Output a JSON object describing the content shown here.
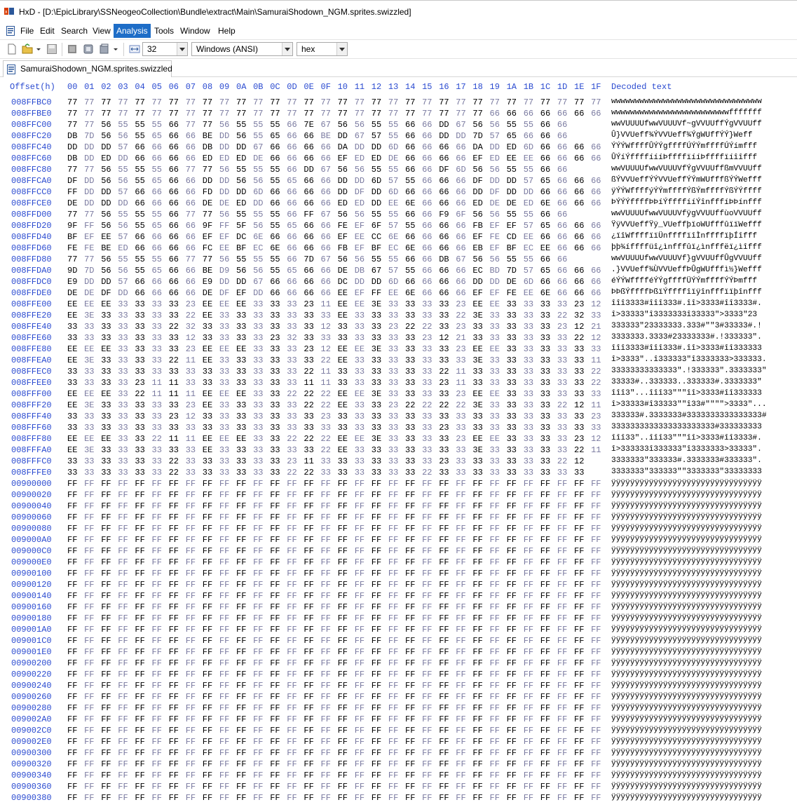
{
  "window": {
    "title": "HxD - [D:\\EpicLibrary\\SSNeogeoCollection\\Bundle\\extract\\Main\\SamuraiShodown_NGM.sprites.swizzled]"
  },
  "menu": {
    "items": [
      "File",
      "Edit",
      "Search",
      "View",
      "Analysis",
      "Tools",
      "Window",
      "Help"
    ],
    "active": "Analysis"
  },
  "toolbar": {
    "bytes_per_row": "32",
    "charset": "Windows (ANSI)",
    "mode": "hex"
  },
  "tab": {
    "label": "SamuraiShodown_NGM.sprites.swizzled"
  },
  "colors": {
    "offset_blue": "#2a4ad0",
    "accent": "#1e6dc7",
    "alt_byte": "#7a7aa0"
  },
  "hex": {
    "offset_header": "Offset(h)",
    "column_headers": [
      "00",
      "01",
      "02",
      "03",
      "04",
      "05",
      "06",
      "07",
      "08",
      "09",
      "0A",
      "0B",
      "0C",
      "0D",
      "0E",
      "0F",
      "10",
      "11",
      "12",
      "13",
      "14",
      "15",
      "16",
      "17",
      "18",
      "19",
      "1A",
      "1B",
      "1C",
      "1D",
      "1E",
      "1F"
    ],
    "decoded_header": "Decoded text",
    "rows": [
      {
        "offset": "008FFBC0",
        "bytes": "77 77 77 77 77 77 77 77 77 77 77 77 77 77 77 77 77 77 77 77 77 77 77 77 77 77 77 77 77 77 77 77",
        "text": "wwwwwwwwwwwwwwwwwwwwwwwwwwwwwwww"
      },
      {
        "offset": "008FFBE0",
        "bytes": "77 77 77 77 77 77 77 77 77 77 77 77 77 77 77 77 77 77 77 77 77 77 77 77 77 66 66 66 66 66 66 66",
        "text": "wwwwwwwwwwwwwwwwwwwwwwwwwfffffff"
      },
      {
        "offset": "008FFC00",
        "bytes": "77 77 56 55 55 55 66 77 77 56 55 55 55 66 7E 67 56 56 55 55 66 66 DD 67 56 56 55 55 66 66",
        "text": "wwVUUUUfwwVUUUVf~gVVUUffÝgVVUUff"
      },
      {
        "offset": "008FFC20",
        "bytes": "DB 7D 56 56 55 65 66 66 BE DD 56 55 65 66 66 BE DD 67 57 55 66 66 DD DD 7D 57 65 66 66 66",
        "text": "Û}VVUeff¾ÝVVUeff¾ÝgWUffÝÝ}Weff"
      },
      {
        "offset": "008FFC40",
        "bytes": "DD DD DD 57 66 66 66 66 DB DD DD 67 66 66 66 66 DA DD DD 6D 66 66 66 66 DA DD ED 6D 66 66 66 66",
        "text": "ÝÝÝWffffÛÝÝgffffÚÝÝmffffÚÝímfff"
      },
      {
        "offset": "008FFC60",
        "bytes": "DB DD ED DD 66 66 66 66 ED ED ED DE 66 66 66 66 EF ED ED DE 66 66 66 66 EF ED EE EE 66 66 66 66",
        "text": "ÛÝíÝffffíííÞffffïííÞffffïíîîfff"
      },
      {
        "offset": "008FFC80",
        "bytes": "77 77 56 55 55 55 66 77 77 56 55 55 55 66 DD 67 56 56 55 55 66 66 DF 6D 56 56 55 55 66 66",
        "text": "wwVUUUUfwwVUUUVfÝgVVUUffßmVVUUff"
      },
      {
        "offset": "008FFCA0",
        "bytes": "DF DD 56 56 55 65 66 66 DD DD 56 56 55 65 66 66 DD DD 6D 57 55 66 66 66 DF DD DD 57 65 66 66 66",
        "text": "ßÝVVUeffÝÝVVUeffÝÝmWUfffßÝÝWefff"
      },
      {
        "offset": "008FFCC0",
        "bytes": "FF DD DD 57 66 66 66 66 FD DD DD 6D 66 66 66 66 DD DF DD 6D 66 66 66 66 DD DF DD DD 66 66 66 66",
        "text": "ÿÝÝWffffýÝÝmffffÝßÝmffffÝßÝÝffff"
      },
      {
        "offset": "008FFCE0",
        "bytes": "DE DD DD DD 66 66 66 66 DE DE ED DD 66 66 66 66 ED ED DD EE 6E 66 66 66 ED DE DE ED 6E 66 66 66",
        "text": "ÞÝÝÝffffÞÞíÝffffííÝînfffíÞÞínfff"
      },
      {
        "offset": "008FFD00",
        "bytes": "77 77 56 55 55 55 66 77 77 56 55 55 55 66 FF 67 56 56 55 55 66 66 F9 6F 56 56 55 55 66 66",
        "text": "wwVUUUUfwwVUUUVfÿgVVUUffùoVVUUff"
      },
      {
        "offset": "008FFD20",
        "bytes": "9F FF 56 56 55 65 66 66 9F FF 5F 56 55 65 66 66 FE EF 6F 57 55 66 66 66 FB EF EF 57 65 66 66 66",
        "text": "ŸÿVVUeffŸÿ_VUeffþïoWUfffûïïWefff"
      },
      {
        "offset": "008FFD40",
        "bytes": "BF EF EE 57 66 66 66 66 EF EF DC 6E 66 66 66 66 EF EE CC 6E 66 66 66 66 EF FE CD EE 66 66 66 66",
        "text": "¿ïîWffffïïÜnffffïîÌnffffïþÍîfff"
      },
      {
        "offset": "008FFD60",
        "bytes": "FE FE BE ED 66 66 66 66 FC EE BF EC 6E 66 66 66 FB EF BF EC 6E 66 66 66 EB EF BF EC EE 66 66 66",
        "text": "þþ¾íffffüî¿ìnfffûï¿ìnfffëï¿ìîfff"
      },
      {
        "offset": "008FFD80",
        "bytes": "77 77 56 55 55 55 66 77 77 56 55 55 55 66 7D 67 56 56 55 55 66 66 DB 67 56 56 55 55 66 66",
        "text": "wwVUUUUfwwVUUUVf}gVVUUffÛgVVUUff"
      },
      {
        "offset": "008FFDA0",
        "bytes": "9D 7D 56 56 55 65 66 66 BE D9 56 56 55 65 66 66 DE DB 67 57 55 66 66 66 EC BD 7D 57 65 66 66 66",
        "text": ".}VVUeff¾ÙVVUeffÞÛgWUfffì½}Wefff"
      },
      {
        "offset": "008FFDC0",
        "bytes": "E9 DD DD 57 66 66 66 66 E9 DD DD 67 66 66 66 66 DC DD DD 6D 66 66 66 66 DD DD DE 6D 66 66 66 66",
        "text": "éÝÝWfffféÝÝgffffÜÝÝmffffÝÝÞmfff"
      },
      {
        "offset": "008FFDE0",
        "bytes": "DE DE DF DD 66 66 66 66 DE DF EF DD 66 66 66 66 EE EF FF EE 6E 66 66 66 EF EF FE EE 6E 66 66 66",
        "text": "ÞÞßÝffffÞßïÝffffîïÿînfffïïþînfff"
      },
      {
        "offset": "008FFE00",
        "bytes": "EE EE EE 33 33 33 33 23 EE EE EE 33 33 33 23 11 EE EE 3E 33 33 33 33 23 EE EE 33 33 33 33 23 12",
        "text": "îîî3333#îîî333#.îî>3333#îî3333#."
      },
      {
        "offset": "008FFE20",
        "bytes": "EE 3E 33 33 33 33 33 22 EE 33 33 33 33 33 33 33 EE 33 33 33 33 33 33 22 3E 33 33 33 33 22 32 33",
        "text": "î>33333\"î3333333î33333\">3333\"23"
      },
      {
        "offset": "008FFE40",
        "bytes": "33 33 33 33 33 33 22 32 33 33 33 33 33 33 33 12 33 33 33 23 22 22 33 23 33 33 33 33 33 23 12 21",
        "text": "333333\"23333333.333#\"\"3#33333#.!"
      },
      {
        "offset": "008FFE60",
        "bytes": "33 33 33 33 33 33 33 12 33 33 33 33 23 32 33 33 33 33 33 33 33 23 12 21 33 33 33 33 33 33 22 12",
        "text": "3333333.3333#23333333#.!333333\"."
      },
      {
        "offset": "008FFE80",
        "bytes": "EE EE EE 33 33 33 33 23 EE EE EE 33 33 33 23 12 EE EE 3E 33 33 33 33 23 EE EE 33 33 33 33 33 33",
        "text": "îîî3333#îîî333#.îî>3333#îî333333"
      },
      {
        "offset": "008FFEA0",
        "bytes": "EE 3E 33 33 33 33 22 11 EE 33 33 33 33 33 33 22 EE 33 33 33 33 33 33 33 3E 33 33 33 33 33 33 11",
        "text": "î>3333\"..î333333\"î3333333>333333."
      },
      {
        "offset": "008FFEC0",
        "bytes": "33 33 33 33 33 33 33 33 33 33 33 33 33 33 22 11 33 33 33 33 33 33 22 11 33 33 33 33 33 33 33 22",
        "text": "33333333333333\".!333333\".3333333\""
      },
      {
        "offset": "008FFEE0",
        "bytes": "33 33 33 33 23 11 11 33 33 33 33 33 33 33 11 11 33 33 33 33 33 33 23 11 33 33 33 33 33 33 33 22",
        "text": "33333#..333333..333333#.3333333\""
      },
      {
        "offset": "008FFF00",
        "bytes": "EE EE EE 33 22 11 11 11 EE EE EE 33 33 22 22 22 EE EE 3E 33 33 33 33 23 EE EE 33 33 33 33 33 33",
        "text": "îîî3\"...îîî33\"\"\"îî>3333#îî333333"
      },
      {
        "offset": "008FFF20",
        "bytes": "EE 3E 33 33 33 33 33 23 EE 33 33 33 33 33 22 22 EE 33 33 23 22 22 22 22 3E 33 33 33 33 22 12 11",
        "text": "î>33333#î33333\"\"î33#\"\"\"\">3333\"..."
      },
      {
        "offset": "008FFF40",
        "bytes": "33 33 33 33 33 33 23 12 33 33 33 33 33 33 33 23 33 33 33 33 33 33 33 33 33 33 33 33 33 33 33 23",
        "text": "333333#.3333333#3333333333333333#"
      },
      {
        "offset": "008FFF60",
        "bytes": "33 33 33 33 33 33 33 33 33 33 33 33 33 33 33 33 33 33 33 33 33 33 23 33 33 33 33 33 33 33 33 33",
        "text": "3333333333333333333333#333333333"
      },
      {
        "offset": "008FFF80",
        "bytes": "EE EE EE 33 33 22 11 11 EE EE EE 33 33 22 22 22 EE EE 3E 33 33 33 33 23 EE EE 33 33 33 33 23 12",
        "text": "îîî33\"..îîî33\"\"\"îî>3333#îî3333#."
      },
      {
        "offset": "008FFFA0",
        "bytes": "EE 3E 33 33 33 33 33 33 EE 33 33 33 33 33 33 22 EE 33 33 33 33 33 33 33 3E 33 33 33 33 33 22 11",
        "text": "î>333333î333333\"î3333333>33333\"."
      },
      {
        "offset": "008FFFC0",
        "bytes": "33 33 33 33 33 33 22 33 33 33 33 33 33 23 11 33 33 33 33 33 33 33 23 33 33 33 33 33 33 22 12",
        "text": "3333333\"333333#.3333333#333333\"."
      },
      {
        "offset": "008FFFE0",
        "bytes": "33 33 33 33 33 33 22 33 33 33 33 33 33 22 22 33 33 33 33 33 33 22 33 33 33 33 33 33 33 33 33",
        "text": "3333333\"333333\"\"3333333\"33333333"
      },
      {
        "offset": "00900000",
        "bytes": "FF FF FF FF FF FF FF FF FF FF FF FF FF FF FF FF FF FF FF FF FF FF FF FF FF FF FF FF FF FF FF FF",
        "text": "ÿÿÿÿÿÿÿÿÿÿÿÿÿÿÿÿÿÿÿÿÿÿÿÿÿÿÿÿÿÿÿÿ"
      },
      {
        "offset": "00900020",
        "bytes": "FF FF FF FF FF FF FF FF FF FF FF FF FF FF FF FF FF FF FF FF FF FF FF FF FF FF FF FF FF FF FF FF",
        "text": "ÿÿÿÿÿÿÿÿÿÿÿÿÿÿÿÿÿÿÿÿÿÿÿÿÿÿÿÿÿÿÿÿ"
      },
      {
        "offset": "00900040",
        "bytes": "FF FF FF FF FF FF FF FF FF FF FF FF FF FF FF FF FF FF FF FF FF FF FF FF FF FF FF FF FF FF FF FF",
        "text": "ÿÿÿÿÿÿÿÿÿÿÿÿÿÿÿÿÿÿÿÿÿÿÿÿÿÿÿÿÿÿÿÿ"
      },
      {
        "offset": "00900060",
        "bytes": "FF FF FF FF FF FF FF FF FF FF FF FF FF FF FF FF FF FF FF FF FF FF FF FF FF FF FF FF FF FF FF FF",
        "text": "ÿÿÿÿÿÿÿÿÿÿÿÿÿÿÿÿÿÿÿÿÿÿÿÿÿÿÿÿÿÿÿÿ"
      },
      {
        "offset": "00900080",
        "bytes": "FF FF FF FF FF FF FF FF FF FF FF FF FF FF FF FF FF FF FF FF FF FF FF FF FF FF FF FF FF FF FF FF",
        "text": "ÿÿÿÿÿÿÿÿÿÿÿÿÿÿÿÿÿÿÿÿÿÿÿÿÿÿÿÿÿÿÿÿ"
      },
      {
        "offset": "009000A0",
        "bytes": "FF FF FF FF FF FF FF FF FF FF FF FF FF FF FF FF FF FF FF FF FF FF FF FF FF FF FF FF FF FF FF FF",
        "text": "ÿÿÿÿÿÿÿÿÿÿÿÿÿÿÿÿÿÿÿÿÿÿÿÿÿÿÿÿÿÿÿÿ"
      },
      {
        "offset": "009000C0",
        "bytes": "FF FF FF FF FF FF FF FF FF FF FF FF FF FF FF FF FF FF FF FF FF FF FF FF FF FF FF FF FF FF FF FF",
        "text": "ÿÿÿÿÿÿÿÿÿÿÿÿÿÿÿÿÿÿÿÿÿÿÿÿÿÿÿÿÿÿÿÿ"
      },
      {
        "offset": "009000E0",
        "bytes": "FF FF FF FF FF FF FF FF FF FF FF FF FF FF FF FF FF FF FF FF FF FF FF FF FF FF FF FF FF FF FF FF",
        "text": "ÿÿÿÿÿÿÿÿÿÿÿÿÿÿÿÿÿÿÿÿÿÿÿÿÿÿÿÿÿÿÿÿ"
      },
      {
        "offset": "00900100",
        "bytes": "FF FF FF FF FF FF FF FF FF FF FF FF FF FF FF FF FF FF FF FF FF FF FF FF FF FF FF FF FF FF FF FF",
        "text": "ÿÿÿÿÿÿÿÿÿÿÿÿÿÿÿÿÿÿÿÿÿÿÿÿÿÿÿÿÿÿÿÿ"
      },
      {
        "offset": "00900120",
        "bytes": "FF FF FF FF FF FF FF FF FF FF FF FF FF FF FF FF FF FF FF FF FF FF FF FF FF FF FF FF FF FF FF FF",
        "text": "ÿÿÿÿÿÿÿÿÿÿÿÿÿÿÿÿÿÿÿÿÿÿÿÿÿÿÿÿÿÿÿÿ"
      },
      {
        "offset": "00900140",
        "bytes": "FF FF FF FF FF FF FF FF FF FF FF FF FF FF FF FF FF FF FF FF FF FF FF FF FF FF FF FF FF FF FF FF",
        "text": "ÿÿÿÿÿÿÿÿÿÿÿÿÿÿÿÿÿÿÿÿÿÿÿÿÿÿÿÿÿÿÿÿ"
      },
      {
        "offset": "00900160",
        "bytes": "FF FF FF FF FF FF FF FF FF FF FF FF FF FF FF FF FF FF FF FF FF FF FF FF FF FF FF FF FF FF FF FF",
        "text": "ÿÿÿÿÿÿÿÿÿÿÿÿÿÿÿÿÿÿÿÿÿÿÿÿÿÿÿÿÿÿÿÿ"
      },
      {
        "offset": "00900180",
        "bytes": "FF FF FF FF FF FF FF FF FF FF FF FF FF FF FF FF FF FF FF FF FF FF FF FF FF FF FF FF FF FF FF FF",
        "text": "ÿÿÿÿÿÿÿÿÿÿÿÿÿÿÿÿÿÿÿÿÿÿÿÿÿÿÿÿÿÿÿÿ"
      },
      {
        "offset": "009001A0",
        "bytes": "FF FF FF FF FF FF FF FF FF FF FF FF FF FF FF FF FF FF FF FF FF FF FF FF FF FF FF FF FF FF FF FF",
        "text": "ÿÿÿÿÿÿÿÿÿÿÿÿÿÿÿÿÿÿÿÿÿÿÿÿÿÿÿÿÿÿÿÿ"
      },
      {
        "offset": "009001C0",
        "bytes": "FF FF FF FF FF FF FF FF FF FF FF FF FF FF FF FF FF FF FF FF FF FF FF FF FF FF FF FF FF FF FF FF",
        "text": "ÿÿÿÿÿÿÿÿÿÿÿÿÿÿÿÿÿÿÿÿÿÿÿÿÿÿÿÿÿÿÿÿ"
      },
      {
        "offset": "009001E0",
        "bytes": "FF FF FF FF FF FF FF FF FF FF FF FF FF FF FF FF FF FF FF FF FF FF FF FF FF FF FF FF FF FF FF FF",
        "text": "ÿÿÿÿÿÿÿÿÿÿÿÿÿÿÿÿÿÿÿÿÿÿÿÿÿÿÿÿÿÿÿÿ"
      },
      {
        "offset": "00900200",
        "bytes": "FF FF FF FF FF FF FF FF FF FF FF FF FF FF FF FF FF FF FF FF FF FF FF FF FF FF FF FF FF FF FF FF",
        "text": "ÿÿÿÿÿÿÿÿÿÿÿÿÿÿÿÿÿÿÿÿÿÿÿÿÿÿÿÿÿÿÿÿ"
      },
      {
        "offset": "00900220",
        "bytes": "FF FF FF FF FF FF FF FF FF FF FF FF FF FF FF FF FF FF FF FF FF FF FF FF FF FF FF FF FF FF FF FF",
        "text": "ÿÿÿÿÿÿÿÿÿÿÿÿÿÿÿÿÿÿÿÿÿÿÿÿÿÿÿÿÿÿÿÿ"
      },
      {
        "offset": "00900240",
        "bytes": "FF FF FF FF FF FF FF FF FF FF FF FF FF FF FF FF FF FF FF FF FF FF FF FF FF FF FF FF FF FF FF FF",
        "text": "ÿÿÿÿÿÿÿÿÿÿÿÿÿÿÿÿÿÿÿÿÿÿÿÿÿÿÿÿÿÿÿÿ"
      },
      {
        "offset": "00900260",
        "bytes": "FF FF FF FF FF FF FF FF FF FF FF FF FF FF FF FF FF FF FF FF FF FF FF FF FF FF FF FF FF FF FF FF",
        "text": "ÿÿÿÿÿÿÿÿÿÿÿÿÿÿÿÿÿÿÿÿÿÿÿÿÿÿÿÿÿÿÿÿ"
      },
      {
        "offset": "00900280",
        "bytes": "FF FF FF FF FF FF FF FF FF FF FF FF FF FF FF FF FF FF FF FF FF FF FF FF FF FF FF FF FF FF FF FF",
        "text": "ÿÿÿÿÿÿÿÿÿÿÿÿÿÿÿÿÿÿÿÿÿÿÿÿÿÿÿÿÿÿÿÿ"
      },
      {
        "offset": "009002A0",
        "bytes": "FF FF FF FF FF FF FF FF FF FF FF FF FF FF FF FF FF FF FF FF FF FF FF FF FF FF FF FF FF FF FF FF",
        "text": "ÿÿÿÿÿÿÿÿÿÿÿÿÿÿÿÿÿÿÿÿÿÿÿÿÿÿÿÿÿÿÿÿ"
      },
      {
        "offset": "009002C0",
        "bytes": "FF FF FF FF FF FF FF FF FF FF FF FF FF FF FF FF FF FF FF FF FF FF FF FF FF FF FF FF FF FF FF FF",
        "text": "ÿÿÿÿÿÿÿÿÿÿÿÿÿÿÿÿÿÿÿÿÿÿÿÿÿÿÿÿÿÿÿÿ"
      },
      {
        "offset": "009002E0",
        "bytes": "FF FF FF FF FF FF FF FF FF FF FF FF FF FF FF FF FF FF FF FF FF FF FF FF FF FF FF FF FF FF FF FF",
        "text": "ÿÿÿÿÿÿÿÿÿÿÿÿÿÿÿÿÿÿÿÿÿÿÿÿÿÿÿÿÿÿÿÿ"
      },
      {
        "offset": "00900300",
        "bytes": "FF FF FF FF FF FF FF FF FF FF FF FF FF FF FF FF FF FF FF FF FF FF FF FF FF FF FF FF FF FF FF FF",
        "text": "ÿÿÿÿÿÿÿÿÿÿÿÿÿÿÿÿÿÿÿÿÿÿÿÿÿÿÿÿÿÿÿÿ"
      },
      {
        "offset": "00900320",
        "bytes": "FF FF FF FF FF FF FF FF FF FF FF FF FF FF FF FF FF FF FF FF FF FF FF FF FF FF FF FF FF FF FF FF",
        "text": "ÿÿÿÿÿÿÿÿÿÿÿÿÿÿÿÿÿÿÿÿÿÿÿÿÿÿÿÿÿÿÿÿ"
      },
      {
        "offset": "00900340",
        "bytes": "FF FF FF FF FF FF FF FF FF FF FF FF FF FF FF FF FF FF FF FF FF FF FF FF FF FF FF FF FF FF FF FF",
        "text": "ÿÿÿÿÿÿÿÿÿÿÿÿÿÿÿÿÿÿÿÿÿÿÿÿÿÿÿÿÿÿÿÿ"
      },
      {
        "offset": "00900360",
        "bytes": "FF FF FF FF FF FF FF FF FF FF FF FF FF FF FF FF FF FF FF FF FF FF FF FF FF FF FF FF FF FF FF FF",
        "text": "ÿÿÿÿÿÿÿÿÿÿÿÿÿÿÿÿÿÿÿÿÿÿÿÿÿÿÿÿÿÿÿÿ"
      },
      {
        "offset": "00900380",
        "bytes": "FF FF FF FF FF FF FF FF FF FF FF FF FF FF FF FF FF FF FF FF FF FF FF FF FF FF FF FF FF FF FF FF",
        "text": "ÿÿÿÿÿÿÿÿÿÿÿÿÿÿÿÿÿÿÿÿÿÿÿÿÿÿÿÿÿÿÿÿ"
      }
    ]
  }
}
